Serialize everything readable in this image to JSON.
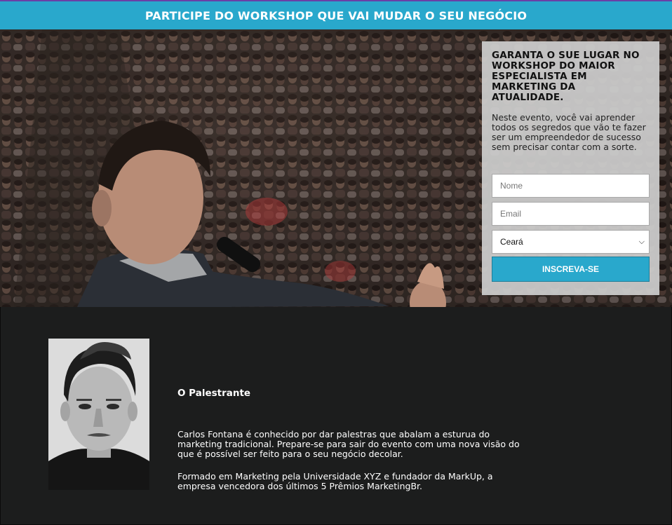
{
  "banner": {
    "title": "PARTICIPE DO WORKSHOP QUE VAI MUDAR O SEU NEGÓCIO"
  },
  "form": {
    "title": "GARANTA O SUE LUGAR NO WORKSHOP DO MAIOR ESPECIALISTA EM MARKETING DA ATUALIDADE.",
    "description": "Neste evento, você vai aprender todos os segredos que vão te fazer ser um empreendedor de sucesso sem precisar contar com a sorte.",
    "name_placeholder": "Nome",
    "email_placeholder": "Email",
    "state_selected": "Ceará",
    "submit_label": "INSCREVA-SE"
  },
  "speaker": {
    "heading": "O Palestrante",
    "bio_1": "Carlos Fontana é conhecido por dar palestras que abalam a esturua do marketing tradicional. Prepare-se para sair do evento com uma nova visão do que é possível ser feito para o seu negócio decolar.",
    "bio_2": "Formado em Marketing pela Universidade XYZ e fundador da MarkUp, a empresa vencedora dos últimos 5 Prêmios MarketingBr."
  },
  "colors": {
    "accent": "#29a8cc",
    "dark_bg": "#1c1d1d",
    "panel": "#cdcdcd"
  }
}
